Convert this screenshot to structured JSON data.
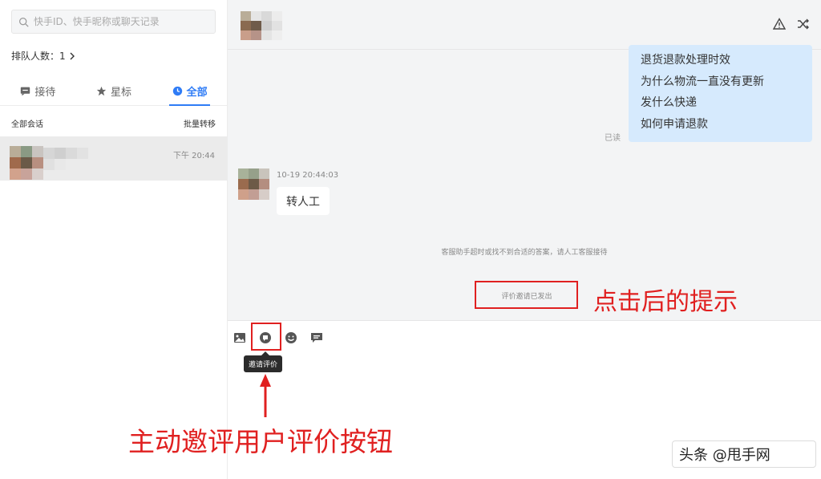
{
  "sidebar": {
    "search_placeholder": "快手ID、快手昵称或聊天记录",
    "queue_label": "排队人数：1",
    "tabs": [
      {
        "label": "接待",
        "icon": "chat-icon"
      },
      {
        "label": "星标",
        "icon": "star-icon"
      },
      {
        "label": "全部",
        "icon": "clock-icon"
      }
    ],
    "list_title": "全部会话",
    "batch_transfer": "批量转移",
    "conversation": {
      "time": "下午 20:44"
    }
  },
  "chat": {
    "header_icons": [
      "warning-icon",
      "shuffle-icon"
    ],
    "faq_lines": [
      "退货退款处理时效",
      "为什么物流一直没有更新",
      "发什么快递",
      "如何申请退款"
    ],
    "read_status": "已读",
    "msg_time": "10-19 20:44:03",
    "user_message": "转人工",
    "system_message": "客服助手超时或找不到合适的答案，请人工客服接待",
    "invite_sent": "评价邀请已发出",
    "toolbar_icons": [
      "image-icon",
      "rate-invite-icon",
      "emoji-icon",
      "quick-reply-icon"
    ],
    "tooltip": "邀请评价"
  },
  "annotations": {
    "hint_text": "点击后的提示",
    "button_text": "主动邀评用户评价按钮",
    "accent": "#e02020"
  },
  "watermark": {
    "text": "头条 @甩手网"
  },
  "colors": {
    "active_tab": "#2f7cf6",
    "faq_bubble": "#d6eafd"
  }
}
